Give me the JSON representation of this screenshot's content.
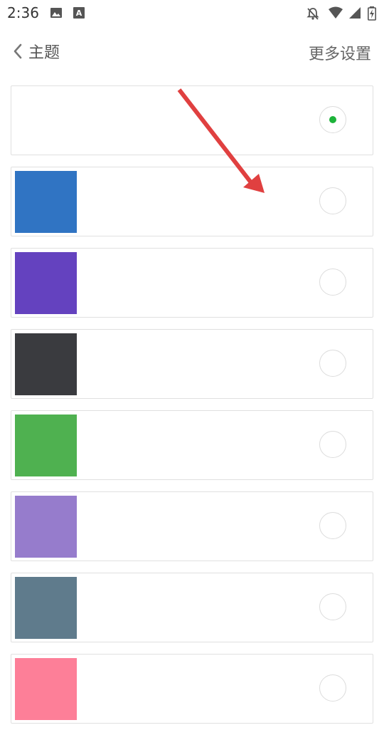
{
  "status_bar": {
    "time": "2:36",
    "icons": [
      "image-icon",
      "font-icon",
      "notifications-off-icon",
      "wifi-icon",
      "signal-icon",
      "battery-charging-icon"
    ]
  },
  "header": {
    "back_icon": "chevron-left-icon",
    "title": "主题",
    "more_settings": "更多设置"
  },
  "colors": {
    "selected_accent": "#1db33a",
    "radio_border": "#dcdcdc",
    "card_border": "#e0e0e0",
    "annotation_arrow": "#e04040"
  },
  "themes": [
    {
      "name": "white",
      "color": "#ffffff",
      "selected": true
    },
    {
      "name": "blue",
      "color": "#3074c3",
      "selected": false
    },
    {
      "name": "purple",
      "color": "#6442bf",
      "selected": false
    },
    {
      "name": "dark",
      "color": "#3a3b3f",
      "selected": false
    },
    {
      "name": "green",
      "color": "#4fb150",
      "selected": false
    },
    {
      "name": "lavender",
      "color": "#967ccc",
      "selected": false
    },
    {
      "name": "slate",
      "color": "#5f7b8c",
      "selected": false
    },
    {
      "name": "pink",
      "color": "#fd7f98",
      "selected": false
    }
  ],
  "annotation": {
    "type": "arrow",
    "icon": "red-arrow-icon"
  }
}
